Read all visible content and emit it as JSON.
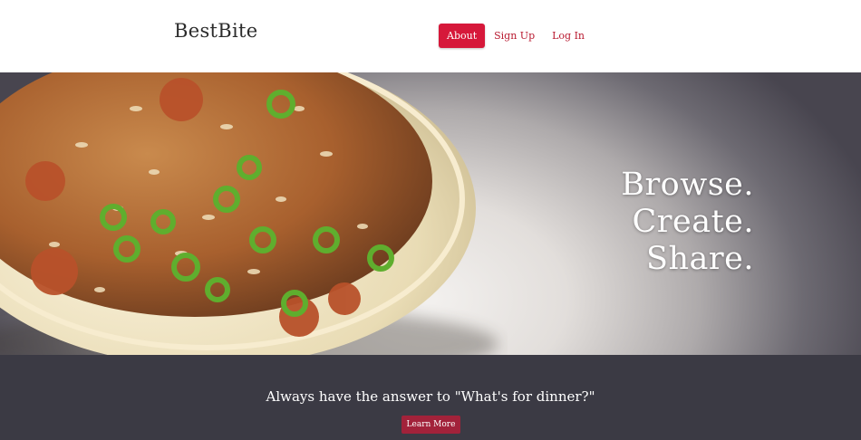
{
  "header": {
    "brand": "BestBite",
    "nav": [
      {
        "label": "About",
        "active": true
      },
      {
        "label": "Sign Up",
        "active": false
      },
      {
        "label": "Log In",
        "active": false
      }
    ]
  },
  "hero": {
    "image_alt": "bowl of rice with sausage and green onions",
    "tagline": [
      "Browse.",
      "Create.",
      "Share."
    ]
  },
  "band": {
    "headline": "Always have the answer to \"What's for dinner?\"",
    "button_label": "Learn More"
  },
  "colors": {
    "accent": "#d6183a",
    "button_dark": "#a2223a",
    "band_bg": "#3b3a44",
    "nav_link": "#b8192f"
  }
}
